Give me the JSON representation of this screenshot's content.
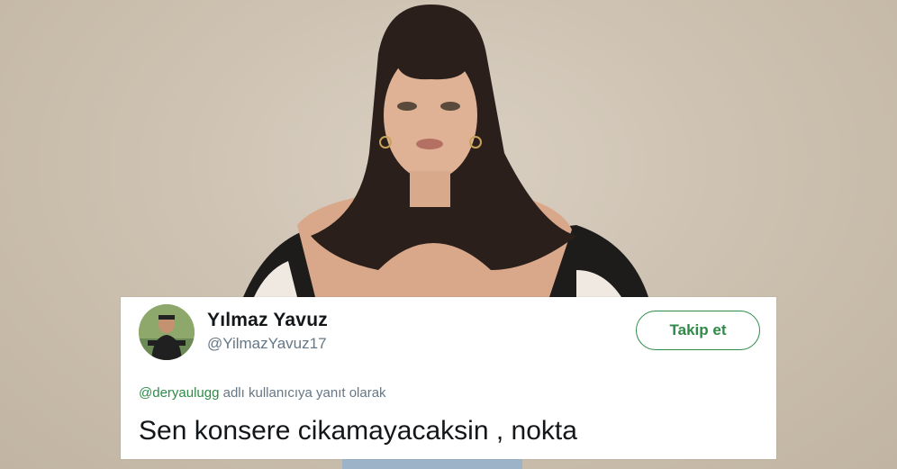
{
  "tweet": {
    "author_name": "Yılmaz Yavuz",
    "author_handle": "@YilmazYavuz17",
    "follow_label": "Takip et",
    "reply_mention": "@deryaulugg",
    "reply_suffix": " adlı kullanıcıya yanıt olarak",
    "text": "Sen konsere cikamayacaksin , nokta"
  },
  "colors": {
    "accent": "#2e8b47",
    "secondary_text": "#657786",
    "primary_text": "#14171a"
  }
}
